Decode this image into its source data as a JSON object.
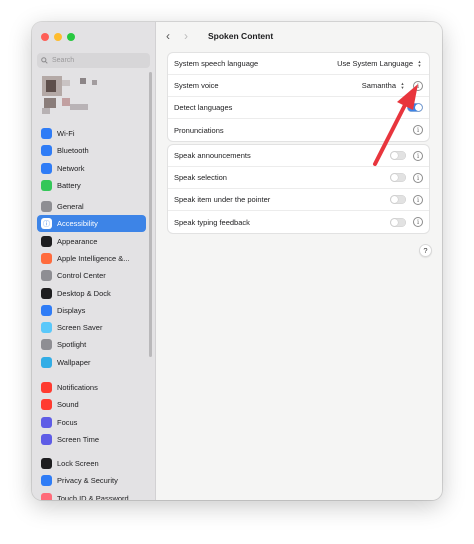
{
  "colors": {
    "accent": "#3d84e7",
    "annotation_arrow": "#e8353d"
  },
  "sidebar": {
    "search_placeholder": "Search",
    "groups": [
      [
        {
          "label": "Wi-Fi",
          "icon": "wifi-icon",
          "color": "#2f7cf6"
        },
        {
          "label": "Bluetooth",
          "icon": "bluetooth-icon",
          "color": "#2f7cf6"
        },
        {
          "label": "Network",
          "icon": "network-icon",
          "color": "#2f7cf6"
        },
        {
          "label": "Battery",
          "icon": "battery-icon",
          "color": "#34c759"
        }
      ],
      [
        {
          "label": "General",
          "icon": "gear-icon",
          "color": "#8e8e93"
        },
        {
          "label": "Accessibility",
          "icon": "accessibility-icon",
          "color": "#2f7cf6",
          "active": true
        },
        {
          "label": "Appearance",
          "icon": "appearance-icon",
          "color": "#1d1d1f"
        },
        {
          "label": "Apple Intelligence &...",
          "icon": "apple-intelligence-icon",
          "color": "#ff6b3d"
        },
        {
          "label": "Control Center",
          "icon": "control-center-icon",
          "color": "#8e8e93"
        },
        {
          "label": "Desktop & Dock",
          "icon": "desktop-dock-icon",
          "color": "#1d1d1f"
        },
        {
          "label": "Displays",
          "icon": "displays-icon",
          "color": "#2f7cf6"
        },
        {
          "label": "Screen Saver",
          "icon": "screen-saver-icon",
          "color": "#5ac8fa"
        },
        {
          "label": "Spotlight",
          "icon": "spotlight-icon",
          "color": "#8e8e93"
        },
        {
          "label": "Wallpaper",
          "icon": "wallpaper-icon",
          "color": "#32ade6"
        }
      ],
      [
        {
          "label": "Notifications",
          "icon": "notifications-icon",
          "color": "#ff3b30"
        },
        {
          "label": "Sound",
          "icon": "sound-icon",
          "color": "#ff3b30"
        },
        {
          "label": "Focus",
          "icon": "focus-icon",
          "color": "#5e5ce6"
        },
        {
          "label": "Screen Time",
          "icon": "screen-time-icon",
          "color": "#5e5ce6"
        }
      ],
      [
        {
          "label": "Lock Screen",
          "icon": "lock-screen-icon",
          "color": "#1d1d1f"
        },
        {
          "label": "Privacy & Security",
          "icon": "privacy-icon",
          "color": "#2f7cf6"
        },
        {
          "label": "Touch ID & Password",
          "icon": "touch-id-icon",
          "color": "#ff6b7a"
        }
      ]
    ]
  },
  "main": {
    "title": "Spoken Content",
    "group1": [
      {
        "label": "System speech language",
        "value": "Use System Language",
        "control": "popup"
      },
      {
        "label": "System voice",
        "value": "Samantha",
        "control": "popup-info"
      },
      {
        "label": "Detect languages",
        "control": "toggle",
        "on": true
      },
      {
        "label": "Pronunciations",
        "control": "info"
      }
    ],
    "group2": [
      {
        "label": "Speak announcements",
        "control": "toggle-info",
        "on": false
      },
      {
        "label": "Speak selection",
        "control": "toggle-info",
        "on": false
      },
      {
        "label": "Speak item under the pointer",
        "control": "toggle-info",
        "on": false
      },
      {
        "label": "Speak typing feedback",
        "control": "toggle-info",
        "on": false
      }
    ],
    "help_label": "?"
  }
}
